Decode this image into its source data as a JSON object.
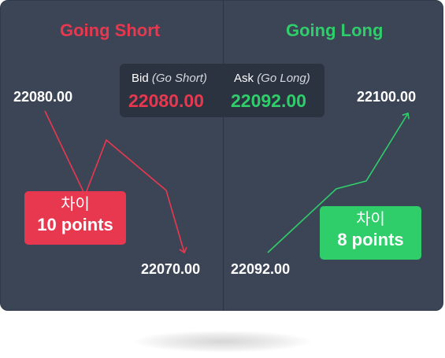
{
  "headings": {
    "short": "Going Short",
    "long": "Going Long"
  },
  "quote": {
    "bid_label": "Bid",
    "bid_note": "(Go Short)",
    "bid_value": "22080.00",
    "ask_label": "Ask",
    "ask_note": "(Go Long)",
    "ask_value": "22092.00"
  },
  "short_side": {
    "start_price": "22080.00",
    "end_price": "22070.00",
    "badge_label": "차이",
    "badge_points": "10 points"
  },
  "long_side": {
    "start_price": "22092.00",
    "end_price": "22100.00",
    "badge_label": "차이",
    "badge_points": "8 points"
  },
  "colors": {
    "short": "#e8384f",
    "long": "#2fce6b",
    "card": "#3c4556",
    "quote_box": "#2c3340"
  }
}
